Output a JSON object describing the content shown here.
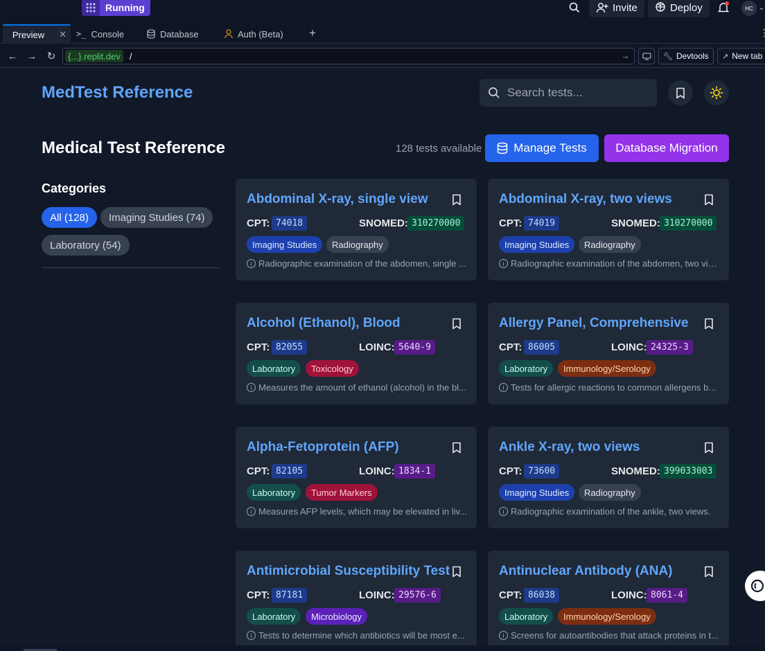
{
  "replit": {
    "run_status": "Running",
    "invite_label": "Invite",
    "deploy_label": "Deploy",
    "avatar_initials": "HC",
    "tabs": [
      {
        "label": "Preview",
        "icon": "monitor-icon",
        "active": true
      },
      {
        "label": "Console",
        "icon": "terminal-icon"
      },
      {
        "label": "Database",
        "icon": "database-icon"
      },
      {
        "label": "Auth (Beta)",
        "icon": "user-icon"
      }
    ],
    "url_host": "{...}.replit.dev",
    "url_path": "/",
    "devtools_label": "Devtools",
    "newtab_label": "New tab"
  },
  "app": {
    "brand": "MedTest Reference",
    "search_placeholder": "Search tests...",
    "page_title": "Medical Test Reference",
    "count_text": "128 tests available",
    "manage_label": "Manage Tests",
    "migrate_label": "Database Migration",
    "categories_title": "Categories",
    "categories": [
      {
        "label": "All (128)",
        "active": true
      },
      {
        "label": "Imaging Studies (74)"
      },
      {
        "label": "Laboratory (54)"
      }
    ]
  },
  "cards": [
    {
      "title": "Abdominal X-ray, single view",
      "cpt": "74018",
      "code2_label": "SNOMED:",
      "code2": "310270000",
      "tags": [
        "Imaging Studies",
        "Radiography"
      ],
      "desc": "Radiographic examination of the abdomen, single ..."
    },
    {
      "title": "Abdominal X-ray, two views",
      "cpt": "74019",
      "code2_label": "SNOMED:",
      "code2": "310270000",
      "tags": [
        "Imaging Studies",
        "Radiography"
      ],
      "desc": "Radiographic examination of the abdomen, two vie..."
    },
    {
      "title": "Alcohol (Ethanol), Blood",
      "cpt": "82055",
      "code2_label": "LOINC:",
      "code2": "5640-9",
      "tags": [
        "Laboratory",
        "Toxicology"
      ],
      "desc": "Measures the amount of ethanol (alcohol) in the bl..."
    },
    {
      "title": "Allergy Panel, Comprehensive",
      "cpt": "86005",
      "code2_label": "LOINC:",
      "code2": "24325-3",
      "tags": [
        "Laboratory",
        "Immunology/Serology"
      ],
      "desc": "Tests for allergic reactions to common allergens b..."
    },
    {
      "title": "Alpha-Fetoprotein (AFP)",
      "cpt": "82105",
      "code2_label": "LOINC:",
      "code2": "1834-1",
      "tags": [
        "Laboratory",
        "Tumor Markers"
      ],
      "desc": "Measures AFP levels, which may be elevated in liv..."
    },
    {
      "title": "Ankle X-ray, two views",
      "cpt": "73600",
      "code2_label": "SNOMED:",
      "code2": "399033003",
      "tags": [
        "Imaging Studies",
        "Radiography"
      ],
      "desc": "Radiographic examination of the ankle, two views."
    },
    {
      "title": "Antimicrobial Susceptibility Test",
      "cpt": "87181",
      "code2_label": "LOINC:",
      "code2": "29576-6",
      "tags": [
        "Laboratory",
        "Microbiology"
      ],
      "desc": "Tests to determine which antibiotics will be most e..."
    },
    {
      "title": "Antinuclear Antibody (ANA)",
      "cpt": "86038",
      "code2_label": "LOINC:",
      "code2": "8061-4",
      "tags": [
        "Laboratory",
        "Immunology/Serology"
      ],
      "desc": "Screens for autoantibodies that attack proteins in t..."
    }
  ],
  "labels": {
    "cpt": "CPT:"
  }
}
